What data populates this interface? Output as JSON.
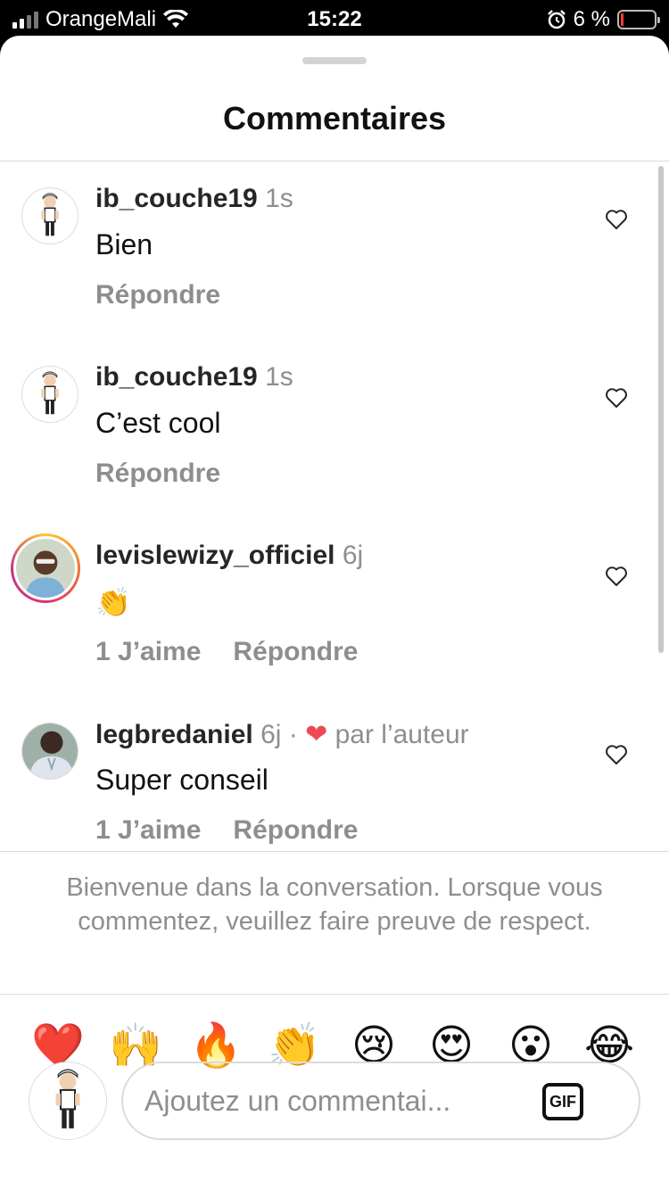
{
  "status_bar": {
    "carrier": "OrangeMali",
    "time": "15:22",
    "battery": "6 %",
    "battery_level": 0.06
  },
  "sheet": {
    "title": "Commentaires"
  },
  "comments": [
    {
      "username": "ib_couche19",
      "time": "1s",
      "text": "Bien",
      "likes_label": "",
      "reply_label": "Répondre",
      "liked_by_author": false
    },
    {
      "username": "ib_couche19",
      "time": "1s",
      "text": "C’est cool",
      "likes_label": "",
      "reply_label": "Répondre",
      "liked_by_author": false
    },
    {
      "username": "levislewizy_officiel",
      "time": "6j",
      "text": "👏",
      "likes_label": "1 J’aime",
      "reply_label": "Répondre",
      "liked_by_author": false
    },
    {
      "username": "legbredaniel",
      "time": "6j ·",
      "author_heart": "❤",
      "author_label": "par l’auteur",
      "text": "Super conseil",
      "likes_label": "1 J’aime",
      "reply_label": "Répondre",
      "liked_by_author": true
    }
  ],
  "welcome_message": "Bienvenue dans la conversation. Lorsque vous commentez, veuillez faire preuve de respect.",
  "reactions": [
    "❤️",
    "🙌",
    "🔥",
    "👏",
    "😢",
    "😍",
    "😮",
    "😂"
  ],
  "composer": {
    "placeholder": "Ajoutez un commentai...",
    "value": "",
    "gif_label": "GIF"
  },
  "colors": {
    "username": "#262626",
    "secondary_text": "#8e8e8e",
    "divider": "#dbdbdb",
    "heart_red": "#ed4956"
  }
}
